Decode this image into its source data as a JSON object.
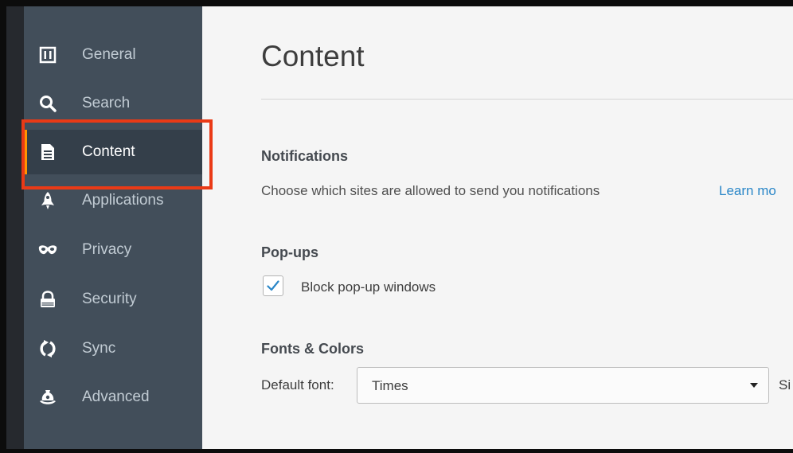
{
  "sidebar": {
    "items": [
      {
        "label": "General",
        "icon": "general-icon"
      },
      {
        "label": "Search",
        "icon": "search-icon"
      },
      {
        "label": "Content",
        "icon": "content-icon",
        "active": true
      },
      {
        "label": "Applications",
        "icon": "applications-icon"
      },
      {
        "label": "Privacy",
        "icon": "privacy-mask-icon"
      },
      {
        "label": "Security",
        "icon": "security-lock-icon"
      },
      {
        "label": "Sync",
        "icon": "sync-icon"
      },
      {
        "label": "Advanced",
        "icon": "advanced-icon"
      }
    ]
  },
  "content": {
    "title": "Content",
    "notifications": {
      "title": "Notifications",
      "description": "Choose which sites are allowed to send you notifications",
      "learn_more": "Learn mo"
    },
    "popups": {
      "title": "Pop-ups",
      "block_label": "Block pop-up windows",
      "block_checked": true
    },
    "fonts": {
      "title": "Fonts & Colors",
      "default_font_label": "Default font:",
      "default_font_value": "Times",
      "size_label": "Si"
    }
  },
  "colors": {
    "sidebar_bg": "#424e5a",
    "active_accent": "#ff9500",
    "highlight_box": "#ea3a16",
    "link": "#2b87c8"
  }
}
